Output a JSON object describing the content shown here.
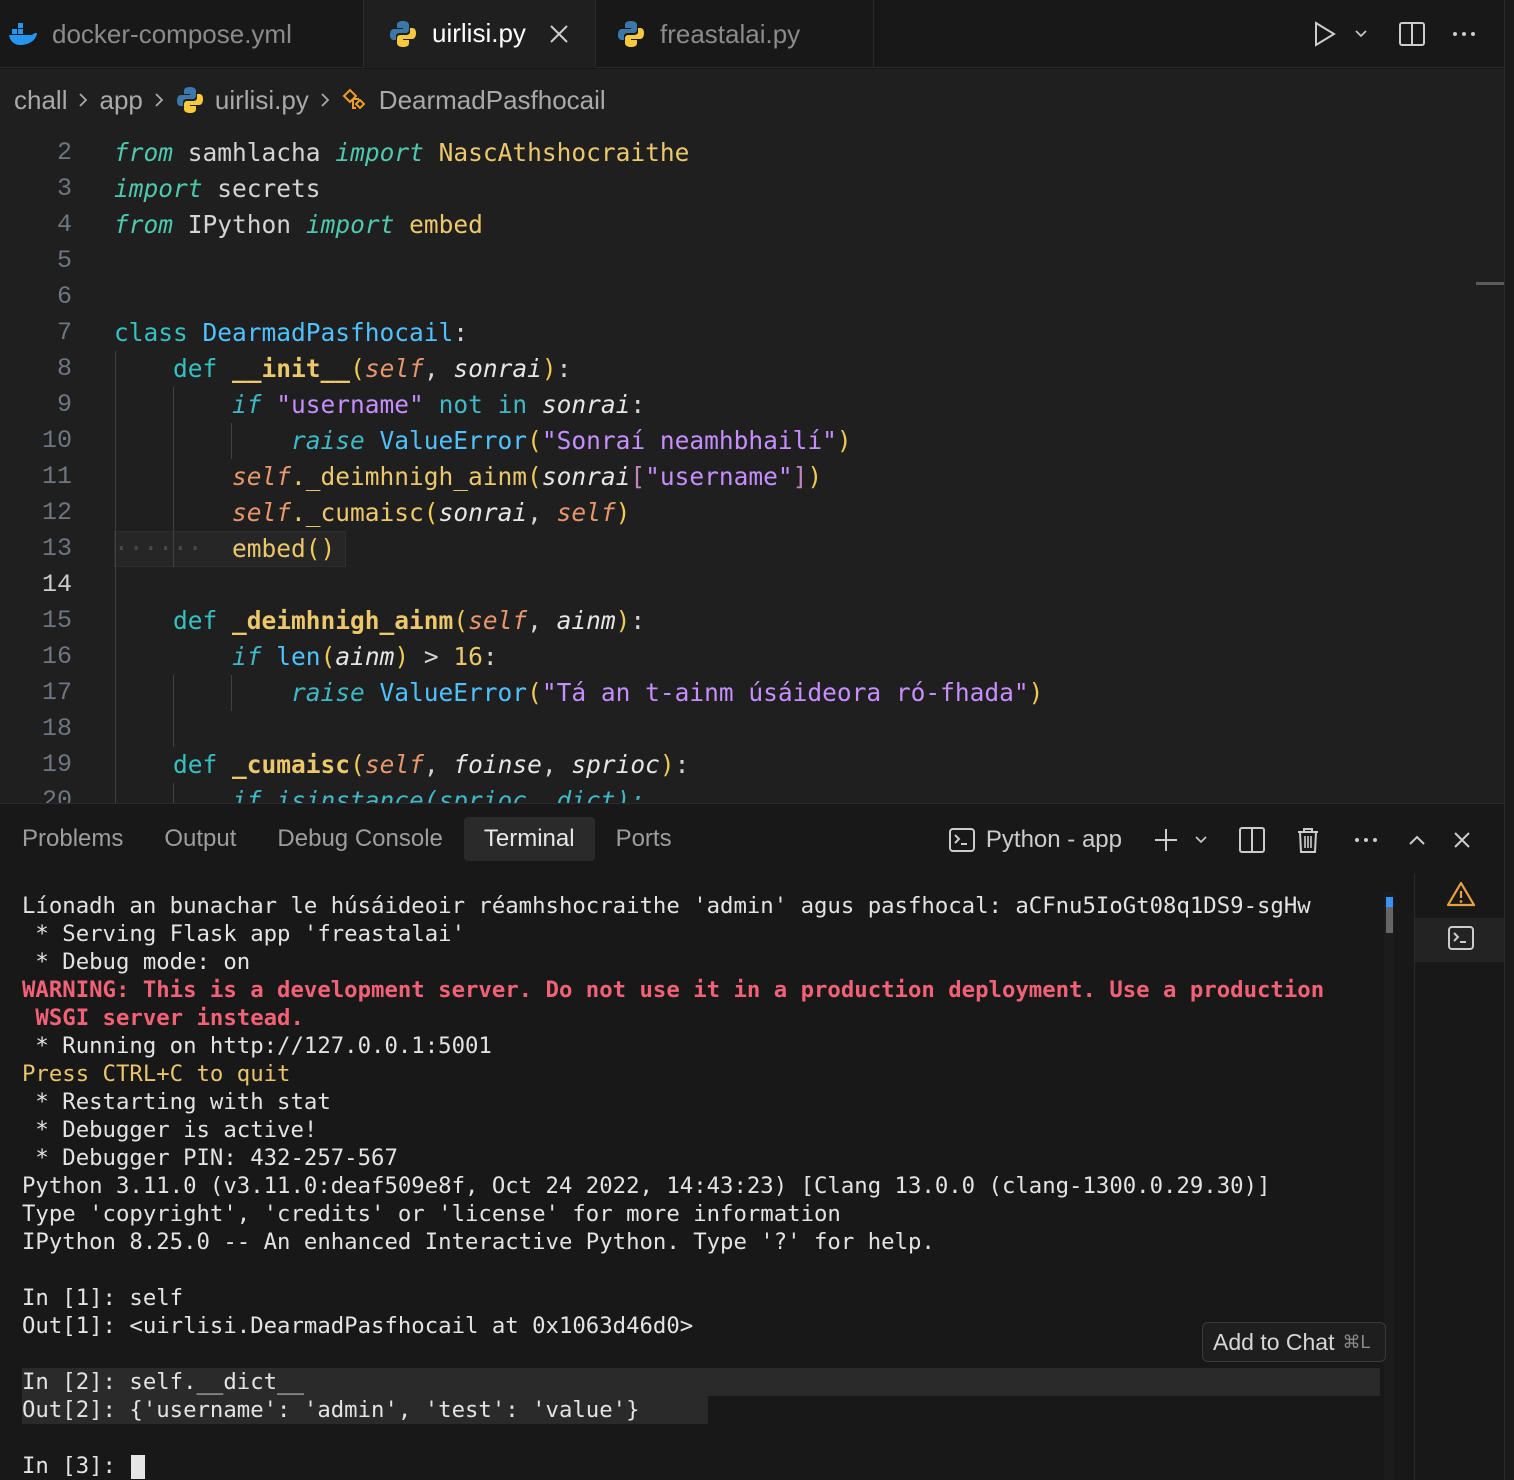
{
  "tabs": [
    {
      "label": "docker-compose.yml",
      "icon": "docker-icon"
    },
    {
      "label": "uirlisi.py",
      "icon": "python-icon",
      "active": true
    },
    {
      "label": "freastalai.py",
      "icon": "python-icon"
    }
  ],
  "breadcrumb": {
    "items": [
      "chall",
      "app",
      "uirlisi.py",
      "DearmadPasfhocail"
    ]
  },
  "editor": {
    "line_numbers": [
      "2",
      "3",
      "4",
      "5",
      "6",
      "7",
      "8",
      "9",
      "10",
      "11",
      "12",
      "13",
      "14",
      "15",
      "16",
      "17",
      "18",
      "19",
      "20"
    ],
    "current_line": "14",
    "lines": {
      "l2": {
        "from": "from",
        "mod": "samhlacha",
        "import": "import",
        "name": "NascAthshocraithe"
      },
      "l3": {
        "import": "import",
        "mod": "secrets"
      },
      "l4": {
        "from": "from",
        "mod": "IPython",
        "import": "import",
        "name": "embed"
      },
      "l7": {
        "kw": "class",
        "name": "DearmadPasfhocail",
        "colon": ":"
      },
      "l8": {
        "kw": "def",
        "name": "__init__",
        "self": "self",
        "param": "sonrai"
      },
      "l9": {
        "if": "if",
        "str": "\"username\"",
        "op": "not in",
        "var": "sonrai"
      },
      "l10": {
        "raise": "raise",
        "cls": "ValueError",
        "str": "\"Sonraí neamhbhailí\""
      },
      "l11": {
        "self": "self",
        "call": "._deimhnigh_ainm",
        "var": "sonrai",
        "str": "\"username\""
      },
      "l12": {
        "self": "self",
        "call": "._cumaisc",
        "var": "sonrai",
        "self2": "self"
      },
      "l13": {
        "dots": "······",
        "call": "embed"
      },
      "l15": {
        "kw": "def",
        "name": "_deimhnigh_ainm",
        "self": "self",
        "param": "ainm"
      },
      "l16": {
        "if": "if",
        "fn": "len",
        "var": "ainm",
        "num": "16"
      },
      "l17": {
        "raise": "raise",
        "cls": "ValueError",
        "str": "\"Tá an t-ainm úsáideora ró-fhada\""
      },
      "l19": {
        "kw": "def",
        "name": "_cumaisc",
        "self": "self",
        "p1": "foinse",
        "p2": "sprioc"
      },
      "l20": {
        "text": "if isinstance(sprioc, dict):"
      }
    }
  },
  "panel": {
    "tabs": [
      "Problems",
      "Output",
      "Debug Console",
      "Terminal",
      "Ports"
    ],
    "active_tab": "Terminal",
    "terminal_name": "Python - app",
    "add_to_chat": "Add to Chat",
    "add_to_chat_shortcut": "⌘L"
  },
  "terminal": {
    "lines": [
      "Líonadh an bunachar le húsáideoir réamhshocraithe 'admin' agus pasfhocal: aCFnu5IoGt08q1DS9-sgHw",
      " * Serving Flask app 'freastalai'",
      " * Debug mode: on"
    ],
    "warning_1": "WARNING: This is a development server. Do not use it in a production deployment. Use a production",
    "warning_2": " WSGI server instead.",
    "running": " * Running on http://127.0.0.1:5001",
    "press": "Press CTRL+C to quit",
    "lines2": [
      " * Restarting with stat",
      " * Debugger is active!",
      " * Debugger PIN: 432-257-567",
      "Python 3.11.0 (v3.11.0:deaf509e8f, Oct 24 2022, 14:43:23) [Clang 13.0.0 (clang-1300.0.29.30)]",
      "Type 'copyright', 'credits' or 'license' for more information",
      "IPython 8.25.0 -- An enhanced Interactive Python. Type '?' for help."
    ],
    "in1": "In [1]: self",
    "out1": "Out[1]: <uirlisi.DearmadPasfhocail at 0x1063d46d0>",
    "in2": "In [2]: self.__dict__",
    "out2": "Out[2]: {'username': 'admin', 'test': 'value'}",
    "in3": "In [3]: "
  }
}
